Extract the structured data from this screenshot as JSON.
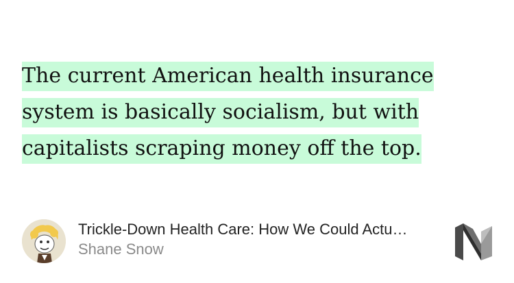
{
  "quote": {
    "lines": [
      "The current American health insurance",
      "system is basically socialism, but with",
      "capitalists scraping money off the top."
    ],
    "highlight_color": "#c8fbd9"
  },
  "story": {
    "title": "Trickle-Down Health Care: How We Could Actu…",
    "author": "Shane Snow"
  },
  "icons": {
    "avatar": "author-avatar",
    "brand": "medium-logo-icon"
  }
}
